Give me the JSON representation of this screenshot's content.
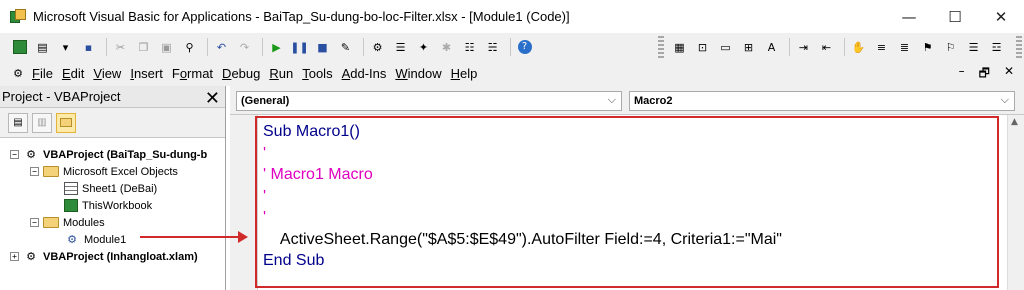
{
  "window": {
    "title": "Microsoft Visual Basic for Applications - BaiTap_Su-dung-bo-loc-Filter.xlsx - [Module1 (Code)]",
    "minimize": "—",
    "maximize": "☐",
    "close": "✕"
  },
  "menubar": {
    "items": [
      {
        "pre": "",
        "ul": "F",
        "post": "ile"
      },
      {
        "pre": "",
        "ul": "E",
        "post": "dit"
      },
      {
        "pre": "",
        "ul": "V",
        "post": "iew"
      },
      {
        "pre": "",
        "ul": "I",
        "post": "nsert"
      },
      {
        "pre": "F",
        "ul": "o",
        "post": "rmat"
      },
      {
        "pre": "",
        "ul": "D",
        "post": "ebug"
      },
      {
        "pre": "",
        "ul": "R",
        "post": "un"
      },
      {
        "pre": "",
        "ul": "T",
        "post": "ools"
      },
      {
        "pre": "",
        "ul": "A",
        "post": "dd-Ins"
      },
      {
        "pre": "",
        "ul": "W",
        "post": "indow"
      },
      {
        "pre": "",
        "ul": "H",
        "post": "elp"
      }
    ],
    "right_min": "–",
    "right_restore": "🗗",
    "right_close": "✕"
  },
  "project": {
    "title": "Project - VBAProject",
    "close": "✕",
    "tree": {
      "root1": "VBAProject (BaiTap_Su-dung-b",
      "excel_objects": "Microsoft Excel Objects",
      "sheet1": "Sheet1 (DeBai)",
      "thisworkbook": "ThisWorkbook",
      "modules": "Modules",
      "module1": "Module1",
      "root2": "VBAProject (Inhangloat.xlam)"
    }
  },
  "code": {
    "object_combo": "(General)",
    "proc_combo": "Macro2",
    "lines": {
      "l1_kw": "Sub",
      "l1_rest": " Macro1()",
      "l2": "'",
      "l3": "' Macro1 Macro",
      "l4": "'",
      "l5": "",
      "l6": "'",
      "l7": "    ActiveSheet.Range(\"$A$5:$E$49\").AutoFilter Field:=4, Criteria1:=\"Mai\"",
      "l8": "End Sub"
    }
  },
  "colors": {
    "highlight": "#d12a2a",
    "keyword": "#00008b",
    "comment": "#e000c0"
  }
}
